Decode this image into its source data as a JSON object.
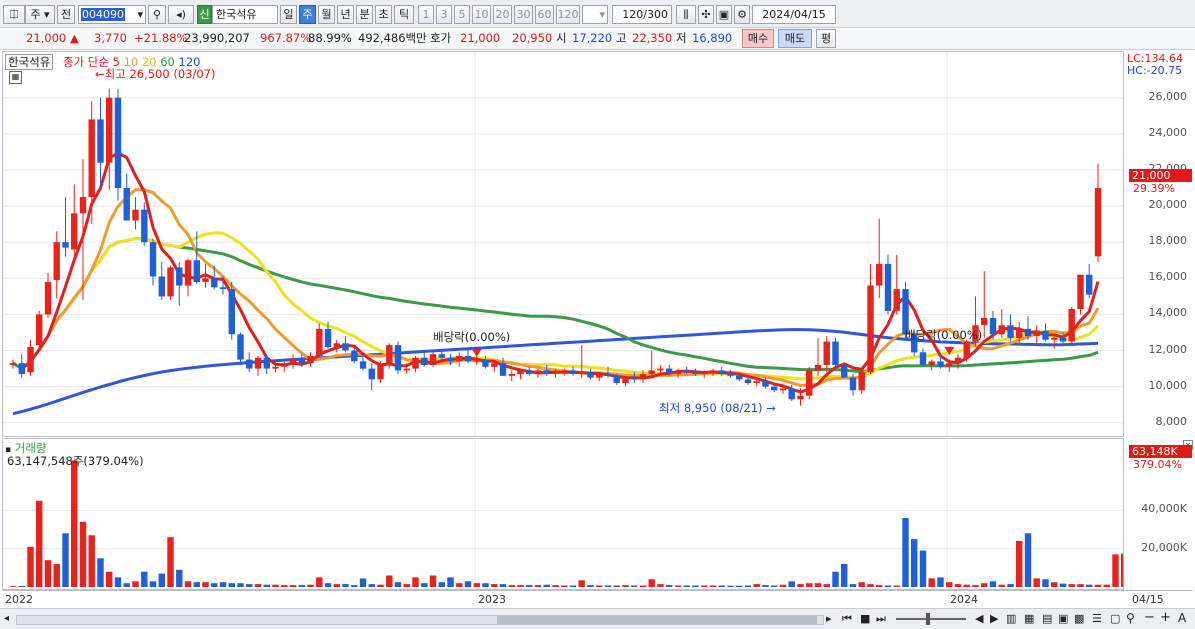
{
  "toolbar": {
    "market": "주",
    "prev": "전",
    "code": "004090",
    "badge": "신",
    "name": "한국석유",
    "periods": [
      "일",
      "주",
      "월",
      "년",
      "분",
      "초",
      "틱"
    ],
    "active_period": "주",
    "nums": [
      "1",
      "3",
      "5",
      "10",
      "20",
      "30",
      "60",
      "120"
    ],
    "count": "120",
    "count_total": "/300",
    "date": "2024/04/15"
  },
  "quote": {
    "price": "21,000",
    "change": "3,770",
    "change_pct": "+21.88%",
    "volume": "23,990,207",
    "vol_ratio": "967.87%",
    "ratio2": "88.99%",
    "amount": "492,486백만",
    "hoga_label": "호가",
    "ask": "21,000",
    "bid": "20,950",
    "open_label": "시",
    "open": "17,220",
    "high_label": "고",
    "high": "22,350",
    "low_label": "저",
    "low": "16,890",
    "buy": "매수",
    "sell": "매도",
    "eval": "평"
  },
  "colors": {
    "up": "#e8221c",
    "down": "#1f5fd8",
    "ma5": "#e0201c",
    "ma10": "#f29a2e",
    "ma20": "#f0e020",
    "ma60": "#3a9a4a",
    "ma120": "#2f57d8"
  },
  "chart_data": {
    "type": "candlestick",
    "price_panel": {
      "title": "한국석유",
      "legend_prefix": "종가 단순",
      "ma_periods": [
        "5",
        "10",
        "20",
        "60",
        "120"
      ],
      "annotations": {
        "max_label": "최고 26,500 (03/07)",
        "min_label": "최저 8,950 (08/21)",
        "dividend_1": "배당락(0.00%)",
        "dividend_2": "배당락(0.00%)"
      },
      "lc": "LC:134.64",
      "hc": "HC:-20.75",
      "last_tag": "21,000",
      "last_pct": "29.39%",
      "ylim": [
        7600,
        28200
      ],
      "yticks": [
        "8,000",
        "10,000",
        "12,000",
        "14,000",
        "16,000",
        "18,000",
        "20,000",
        "22,000",
        "24,000",
        "26,000"
      ],
      "candles": [
        [
          11200,
          11500,
          11000,
          11300
        ],
        [
          11300,
          11800,
          10500,
          10700
        ],
        [
          10800,
          12600,
          10600,
          12200
        ],
        [
          12300,
          14200,
          12100,
          14000
        ],
        [
          14000,
          16300,
          13800,
          15800
        ],
        [
          15900,
          18600,
          14900,
          18000
        ],
        [
          18000,
          20500,
          17200,
          17700
        ],
        [
          17600,
          21200,
          17000,
          19600
        ],
        [
          19600,
          22600,
          14800,
          20500
        ],
        [
          20500,
          25800,
          19000,
          24800
        ],
        [
          24800,
          26000,
          21000,
          22400
        ],
        [
          22400,
          26500,
          20900,
          26000
        ],
        [
          26000,
          26500,
          20300,
          21000
        ],
        [
          21000,
          21800,
          19200,
          19200
        ],
        [
          19200,
          20500,
          18700,
          19800
        ],
        [
          19800,
          20200,
          17800,
          18000
        ],
        [
          18000,
          18200,
          15600,
          16100
        ],
        [
          16100,
          16900,
          14800,
          15000
        ],
        [
          15000,
          16700,
          14800,
          16600
        ],
        [
          16600,
          16900,
          14500,
          15600
        ],
        [
          15600,
          17100,
          15000,
          17000
        ],
        [
          17000,
          18600,
          15700,
          15800
        ],
        [
          15800,
          16800,
          15500,
          16000
        ],
        [
          16000,
          16700,
          15400,
          15500
        ],
        [
          15500,
          16100,
          15100,
          15400
        ],
        [
          15400,
          15800,
          12600,
          12900
        ],
        [
          12900,
          13000,
          11200,
          11500
        ],
        [
          11500,
          11900,
          10800,
          11000
        ],
        [
          11000,
          11700,
          10600,
          11600
        ],
        [
          11600,
          11800,
          10700,
          11000
        ],
        [
          11000,
          11300,
          10800,
          11100
        ],
        [
          11100,
          11400,
          10800,
          11300
        ],
        [
          11300,
          11800,
          11000,
          11500
        ],
        [
          11500,
          11800,
          11100,
          11300
        ],
        [
          11300,
          11900,
          11100,
          11700
        ],
        [
          11700,
          13500,
          11600,
          13200
        ],
        [
          13200,
          13600,
          12100,
          12200
        ],
        [
          12200,
          12600,
          11900,
          12400
        ],
        [
          12400,
          12800,
          11900,
          12000
        ],
        [
          12000,
          12200,
          11300,
          11400
        ],
        [
          11400,
          11800,
          10900,
          11000
        ],
        [
          11000,
          11300,
          9800,
          10400
        ],
        [
          10400,
          11400,
          10200,
          11200
        ],
        [
          11200,
          12400,
          11000,
          12300
        ],
        [
          12300,
          12500,
          10700,
          10900
        ],
        [
          10900,
          11300,
          10700,
          11000
        ],
        [
          11000,
          11700,
          10800,
          11600
        ],
        [
          11600,
          12000,
          11100,
          11200
        ],
        [
          11200,
          11900,
          11100,
          11800
        ],
        [
          11800,
          12100,
          11400,
          11600
        ],
        [
          11600,
          11800,
          11200,
          11400
        ],
        [
          11400,
          11900,
          11100,
          11700
        ],
        [
          11700,
          12100,
          11300,
          11400
        ],
        [
          11400,
          11700,
          11200,
          11500
        ],
        [
          11500,
          11700,
          11000,
          11100
        ],
        [
          11100,
          11400,
          10800,
          11300
        ],
        [
          11300,
          11600,
          10600,
          10600
        ],
        [
          10600,
          10900,
          10300,
          10700
        ],
        [
          10700,
          11000,
          10400,
          10900
        ],
        [
          10900,
          11100,
          10600,
          10700
        ],
        [
          10700,
          11000,
          10500,
          10900
        ],
        [
          10900,
          11200,
          10600,
          10700
        ],
        [
          10700,
          11000,
          10500,
          10800
        ],
        [
          10800,
          11000,
          10600,
          10900
        ],
        [
          10900,
          11100,
          10600,
          10700
        ],
        [
          10700,
          12300,
          10500,
          10800
        ],
        [
          10800,
          11000,
          10400,
          10500
        ],
        [
          10500,
          10800,
          10300,
          10700
        ],
        [
          10700,
          11100,
          10500,
          10600
        ],
        [
          10600,
          10700,
          10100,
          10200
        ],
        [
          10200,
          10600,
          10000,
          10500
        ],
        [
          10500,
          10800,
          10200,
          10400
        ],
        [
          10400,
          10900,
          10200,
          10700
        ],
        [
          10700,
          12000,
          10500,
          10900
        ],
        [
          10900,
          11200,
          10700,
          11000
        ],
        [
          11000,
          11200,
          10600,
          10700
        ],
        [
          10700,
          11000,
          10500,
          10900
        ],
        [
          10900,
          11100,
          10700,
          10800
        ],
        [
          10800,
          11000,
          10600,
          10700
        ],
        [
          10700,
          10900,
          10500,
          10800
        ],
        [
          10800,
          11000,
          10600,
          10900
        ],
        [
          10900,
          11100,
          10600,
          10700
        ],
        [
          10700,
          10900,
          10500,
          10600
        ],
        [
          10600,
          10800,
          10300,
          10400
        ],
        [
          10400,
          10600,
          10100,
          10200
        ],
        [
          10200,
          10500,
          10000,
          10300
        ],
        [
          10300,
          10500,
          9900,
          10000
        ],
        [
          10000,
          10200,
          9700,
          9800
        ],
        [
          9800,
          10100,
          9600,
          9900
        ],
        [
          9900,
          10100,
          9200,
          9300
        ],
        [
          9300,
          9900,
          8950,
          9500
        ],
        [
          9500,
          11100,
          9300,
          10900
        ],
        [
          10900,
          12700,
          10600,
          11200
        ],
        [
          11200,
          12800,
          10800,
          12500
        ],
        [
          12500,
          12700,
          11000,
          11200
        ],
        [
          11200,
          11300,
          10500,
          10500
        ],
        [
          10500,
          10700,
          9500,
          9800
        ],
        [
          9800,
          10900,
          9600,
          10800
        ],
        [
          10800,
          16800,
          10700,
          15600
        ],
        [
          15600,
          19300,
          14900,
          16800
        ],
        [
          16800,
          17300,
          14000,
          14200
        ],
        [
          14200,
          17300,
          14000,
          15400
        ],
        [
          15400,
          15800,
          12600,
          12900
        ],
        [
          12900,
          13100,
          11700,
          11900
        ],
        [
          11900,
          12100,
          11100,
          11200
        ],
        [
          11200,
          11500,
          10900,
          11400
        ],
        [
          11400,
          11700,
          11000,
          11100
        ],
        [
          11100,
          11500,
          10800,
          11300
        ],
        [
          11300,
          11800,
          11000,
          11600
        ],
        [
          11600,
          12600,
          11400,
          12500
        ],
        [
          12500,
          15000,
          12200,
          13400
        ],
        [
          13400,
          16400,
          12700,
          13800
        ],
        [
          13800,
          14200,
          12600,
          12900
        ],
        [
          12900,
          14300,
          12700,
          13400
        ],
        [
          13400,
          14000,
          12500,
          12700
        ],
        [
          12700,
          13600,
          12300,
          13200
        ],
        [
          13200,
          13900,
          12600,
          12800
        ],
        [
          12800,
          13400,
          12300,
          13100
        ],
        [
          13100,
          13500,
          12500,
          12600
        ],
        [
          12600,
          12900,
          12100,
          12700
        ],
        [
          12700,
          13000,
          12300,
          12500
        ],
        [
          12500,
          14400,
          12300,
          14300
        ],
        [
          14300,
          16000,
          14000,
          16200
        ],
        [
          16200,
          16800,
          14900,
          15100
        ],
        [
          17220,
          22350,
          16890,
          21000
        ]
      ],
      "ma120": [
        8500,
        8620,
        8750,
        8890,
        9040,
        9200,
        9360,
        9520,
        9680,
        9830,
        9980,
        10120,
        10260,
        10390,
        10510,
        10620,
        10720,
        10810,
        10890,
        10960,
        11020,
        11080,
        11130,
        11180,
        11220,
        11260,
        11300,
        11340,
        11380,
        11410,
        11440,
        11470,
        11500,
        11530,
        11560,
        11590,
        11620,
        11650,
        11680,
        11710,
        11740,
        11770,
        11800,
        11830,
        11860,
        11890,
        11920,
        11950,
        11980,
        12010,
        12040,
        12070,
        12100,
        12130,
        12160,
        12190,
        12220,
        12250,
        12280,
        12310,
        12340,
        12370,
        12400,
        12430,
        12460,
        12490,
        12520,
        12550,
        12580,
        12610,
        12640,
        12670,
        12700,
        12730,
        12760,
        12790,
        12820,
        12850,
        12880,
        12910,
        12940,
        12970,
        13000,
        13030,
        13060,
        13090,
        13110,
        13130,
        13150,
        13160,
        13160,
        13150,
        13130,
        13100,
        13060,
        13010,
        12950,
        12890,
        12830,
        12770,
        12710,
        12660,
        12620,
        12580,
        12540,
        12510,
        12480,
        12460,
        12440,
        12420,
        12400,
        12390,
        12380,
        12370,
        12360,
        12350,
        12340,
        12330,
        12320,
        12310,
        12320,
        12340,
        12360,
        12380,
        12400
      ]
    },
    "volume_panel": {
      "title": "거래량",
      "info": "63,147,548주(379.04%)",
      "last_tag": "63,148K",
      "last_pct": "379.04%",
      "unit": "K",
      "ylim": [
        0,
        72000
      ],
      "yticks": [
        "20,000K",
        "40,000K"
      ],
      "values": [
        400,
        500,
        21000,
        45000,
        14000,
        12000,
        28000,
        66000,
        34000,
        27000,
        15000,
        8000,
        5000,
        2000,
        3000,
        8000,
        3000,
        7000,
        26000,
        9000,
        3000,
        2500,
        2500,
        2000,
        2500,
        2000,
        2000,
        1500,
        1500,
        1200,
        1200,
        1000,
        1000,
        1000,
        1200,
        5000,
        2000,
        1500,
        1500,
        1000,
        4500,
        1500,
        1200,
        6000,
        2500,
        1500,
        5000,
        2000,
        6000,
        2500,
        5000,
        2000,
        3000,
        2000,
        2000,
        1500,
        1500,
        1000,
        1000,
        1000,
        1000,
        1200,
        1000,
        800,
        800,
        3500,
        1000,
        800,
        800,
        800,
        1000,
        800,
        800,
        4000,
        1500,
        1000,
        800,
        800,
        800,
        800,
        800,
        800,
        700,
        700,
        800,
        1500,
        1000,
        800,
        1200,
        3000,
        1500,
        2000,
        2000,
        1500,
        8000,
        12000,
        1500,
        2500,
        1500,
        1000,
        800,
        800,
        36000,
        25000,
        19000,
        4500,
        5000,
        2500,
        1500,
        1200,
        1000,
        2000,
        3000,
        1200,
        1500,
        24000,
        28000,
        4500,
        4000,
        2500,
        1800,
        1500,
        1500,
        1200,
        1200,
        1200,
        17000,
        17500,
        63148
      ]
    },
    "x_labels": [
      "2022",
      "2023",
      "2024",
      "04/15"
    ]
  }
}
